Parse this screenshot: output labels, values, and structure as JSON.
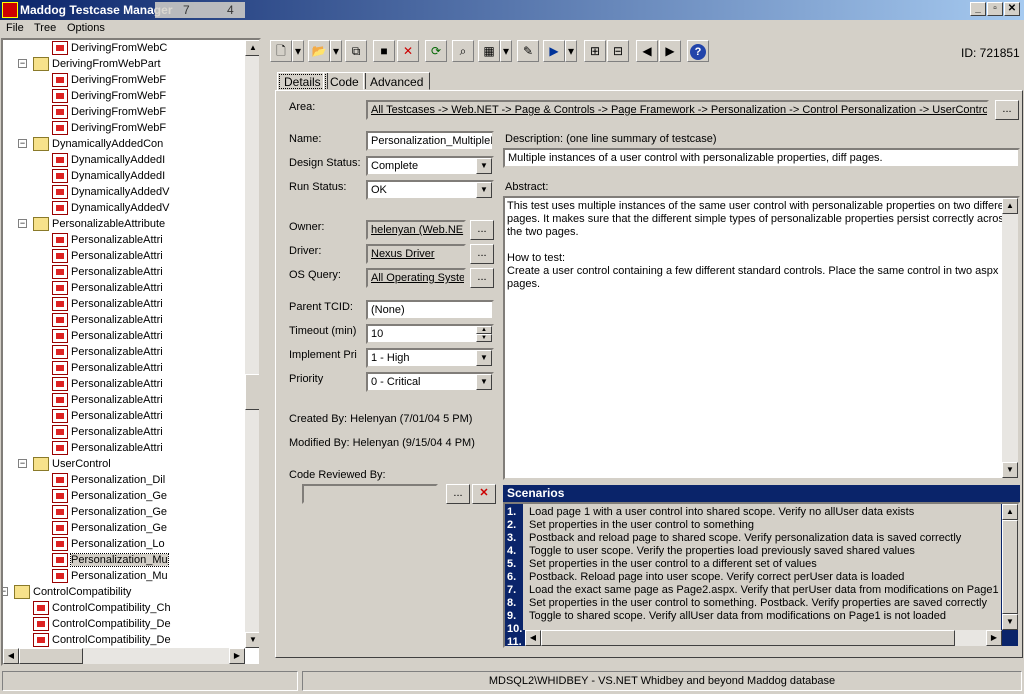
{
  "app": {
    "title": "Maddog Testcase Manager",
    "overlay_a": "7",
    "overlay_b": "4"
  },
  "menu": [
    "File",
    "Tree",
    "Options"
  ],
  "tree": {
    "items": [
      {
        "label": "DerivingFromWebC",
        "level": 3,
        "type": "tc"
      },
      {
        "label": "DerivingFromWebPart",
        "level": 2,
        "type": "folder"
      },
      {
        "label": "DerivingFromWebF",
        "level": 3,
        "type": "tc"
      },
      {
        "label": "DerivingFromWebF",
        "level": 3,
        "type": "tc"
      },
      {
        "label": "DerivingFromWebF",
        "level": 3,
        "type": "tc"
      },
      {
        "label": "DerivingFromWebF",
        "level": 3,
        "type": "tc"
      },
      {
        "label": "DynamicallyAddedCon",
        "level": 2,
        "type": "folder"
      },
      {
        "label": "DynamicallyAddedI",
        "level": 3,
        "type": "tc"
      },
      {
        "label": "DynamicallyAddedI",
        "level": 3,
        "type": "tc"
      },
      {
        "label": "DynamicallyAddedV",
        "level": 3,
        "type": "tc"
      },
      {
        "label": "DynamicallyAddedV",
        "level": 3,
        "type": "tc"
      },
      {
        "label": "PersonalizableAttribute",
        "level": 2,
        "type": "folder"
      },
      {
        "label": "PersonalizableAttri",
        "level": 3,
        "type": "tc"
      },
      {
        "label": "PersonalizableAttri",
        "level": 3,
        "type": "tc"
      },
      {
        "label": "PersonalizableAttri",
        "level": 3,
        "type": "tc"
      },
      {
        "label": "PersonalizableAttri",
        "level": 3,
        "type": "tc"
      },
      {
        "label": "PersonalizableAttri",
        "level": 3,
        "type": "tc"
      },
      {
        "label": "PersonalizableAttri",
        "level": 3,
        "type": "tc"
      },
      {
        "label": "PersonalizableAttri",
        "level": 3,
        "type": "tc"
      },
      {
        "label": "PersonalizableAttri",
        "level": 3,
        "type": "tc"
      },
      {
        "label": "PersonalizableAttri",
        "level": 3,
        "type": "tc"
      },
      {
        "label": "PersonalizableAttri",
        "level": 3,
        "type": "tc"
      },
      {
        "label": "PersonalizableAttri",
        "level": 3,
        "type": "tc"
      },
      {
        "label": "PersonalizableAttri",
        "level": 3,
        "type": "tc"
      },
      {
        "label": "PersonalizableAttri",
        "level": 3,
        "type": "tc"
      },
      {
        "label": "PersonalizableAttri",
        "level": 3,
        "type": "tc"
      },
      {
        "label": "UserControl",
        "level": 2,
        "type": "folder"
      },
      {
        "label": "Personalization_Dil",
        "level": 3,
        "type": "tc"
      },
      {
        "label": "Personalization_Ge",
        "level": 3,
        "type": "tc"
      },
      {
        "label": "Personalization_Ge",
        "level": 3,
        "type": "tc"
      },
      {
        "label": "Personalization_Ge",
        "level": 3,
        "type": "tc"
      },
      {
        "label": "Personalization_Lo",
        "level": 3,
        "type": "tc"
      },
      {
        "label": "Personalization_Mu",
        "level": 3,
        "type": "tc",
        "selected": true
      },
      {
        "label": "Personalization_Mu",
        "level": 3,
        "type": "tc"
      },
      {
        "label": "ControlCompatibility",
        "level": 1,
        "type": "folder"
      },
      {
        "label": "ControlCompatibility_Ch",
        "level": 2,
        "type": "tc"
      },
      {
        "label": "ControlCompatibility_De",
        "level": 2,
        "type": "tc"
      },
      {
        "label": "ControlCompatibility_De",
        "level": 2,
        "type": "tc"
      }
    ]
  },
  "toolbar": {
    "id_label": "ID: 721851"
  },
  "tabs": [
    "Details",
    "Code",
    "Advanced"
  ],
  "form": {
    "area_label": "Area:",
    "area_value": "All Testcases -> Web.NET -> Page & Controls -> Page Framework -> Personalization -> Control Personalization -> UserControl",
    "name_label": "Name:",
    "name_value": "Personalization_MultipleIn",
    "design_status_label": "Design Status:",
    "design_status_value": "Complete",
    "run_status_label": "Run Status:",
    "run_status_value": "OK",
    "owner_label": "Owner:",
    "owner_value": "helenyan (Web.NE",
    "driver_label": "Driver:",
    "driver_value": "Nexus Driver",
    "os_label": "OS Query:",
    "os_value": "All Operating Syste",
    "parent_label": "Parent TCID:",
    "parent_value": "(None)",
    "timeout_label": "Timeout (min)",
    "timeout_value": "10",
    "impl_label": "Implement Pri",
    "impl_value": "1 - High",
    "priority_label": "Priority",
    "priority_value": "0 - Critical",
    "created": "Created By: Helenyan (7/01/04 5 PM)",
    "modified": "Modified By: Helenyan (9/15/04 4 PM)",
    "reviewed_label": "Code Reviewed By:",
    "desc_label": "Description: (one line summary of testcase)",
    "desc_value": "Multiple instances of a user control with personalizable properties, diff pages.",
    "abstract_label": "Abstract:",
    "abstract_lines": [
      "This test uses multiple instances of the same user control with personalizable properties on two different",
      "pages. It makes sure that the different simple types of personalizable properties persist correctly across",
      "the two pages.",
      "",
      "How to test:",
      "Create a user control containing a few different standard controls. Place the same control in two aspx",
      "pages."
    ],
    "ellipsis": "..."
  },
  "scenarios": {
    "title": "Scenarios",
    "items": [
      {
        "n": "1.",
        "t": "Load page 1 with a user control into shared scope. Verify no allUser data exists"
      },
      {
        "n": "2.",
        "t": "Set properties in the user control to something"
      },
      {
        "n": "3.",
        "t": "Postback and reload page to shared scope. Verify personalization data is saved correctly"
      },
      {
        "n": "4.",
        "t": "Toggle to user scope. Verify the properties load previously saved shared values"
      },
      {
        "n": "5.",
        "t": "Set properties in the user control to a different set of values"
      },
      {
        "n": "6.",
        "t": "Postback. Reload page into user scope. Verify correct perUser data is loaded"
      },
      {
        "n": "7.",
        "t": "Load the exact same page as Page2.aspx. Verify that perUser data from modifications on Page1 is nc"
      },
      {
        "n": "8.",
        "t": "Set properties in the user control to something. Postback. Verify properties are saved correctly"
      },
      {
        "n": "9.",
        "t": "Toggle to shared scope. Verify allUser data from modifications on Page1 is not loaded"
      },
      {
        "n": "10.",
        "t": ""
      },
      {
        "n": "11.",
        "t": ""
      }
    ]
  },
  "status": {
    "text": "MDSQL2\\WHIDBEY - VS.NET Whidbey and beyond Maddog database"
  }
}
